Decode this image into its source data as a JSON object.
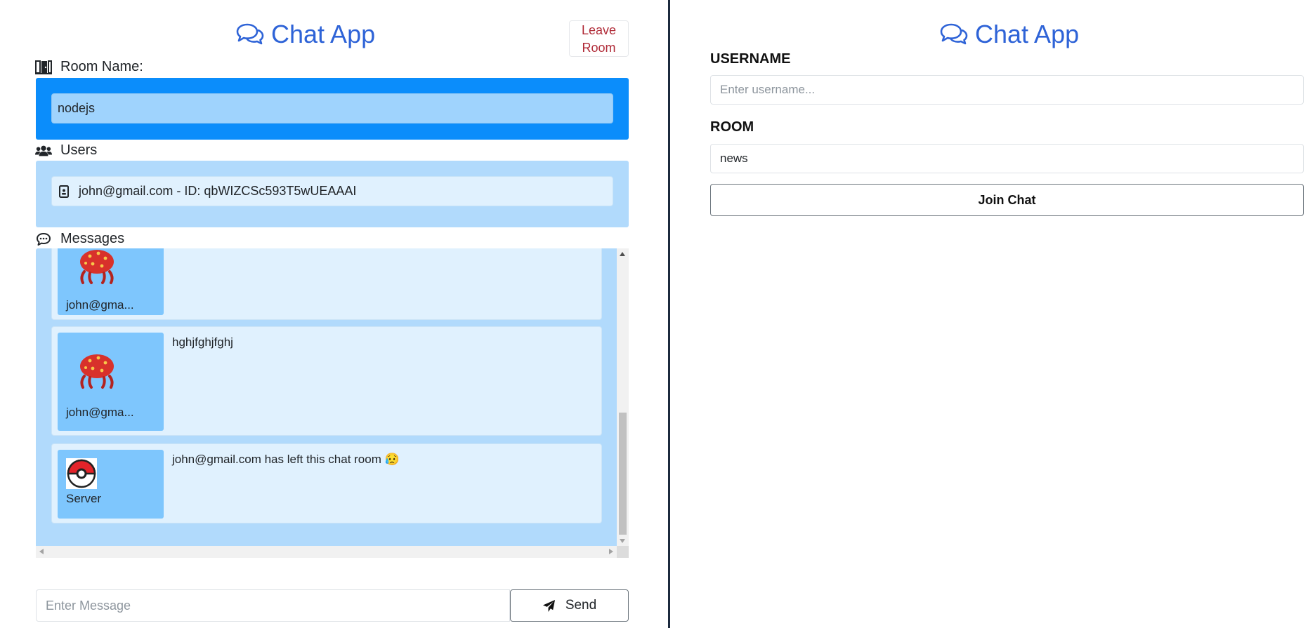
{
  "app": {
    "title": "Chat App",
    "brand_color": "#2e63d7"
  },
  "chat": {
    "leave_button": {
      "line1": "Leave",
      "line2": "Room"
    },
    "room_label": "Room Name:",
    "room_name": "nodejs",
    "users_label": "Users",
    "users": [
      {
        "text": "john@gmail.com - ID: qbWIZCSc593T5wUEAAAI",
        "icon": "id-card-icon"
      }
    ],
    "messages_label": "Messages",
    "messages": [
      {
        "sender": "john@gma...",
        "avatar": "parasect-icon",
        "text": ""
      },
      {
        "sender": "john@gma...",
        "avatar": "parasect-icon",
        "text": "hghjfghjfghj"
      },
      {
        "sender": "Server",
        "avatar": "pokeball-icon",
        "text": "john@gmail.com has left this chat room 😥"
      }
    ],
    "message_input_placeholder": "Enter Message",
    "send_label": "Send"
  },
  "join": {
    "username_label": "USERNAME",
    "username_placeholder": "Enter username...",
    "room_label": "ROOM",
    "room_value": "news",
    "join_label": "Join Chat"
  },
  "colors": {
    "room_box": "#0b8dfb",
    "panel_light": "#b1dafc",
    "avatar_bg": "#7ec6fd",
    "leave_text": "#b02a37"
  }
}
